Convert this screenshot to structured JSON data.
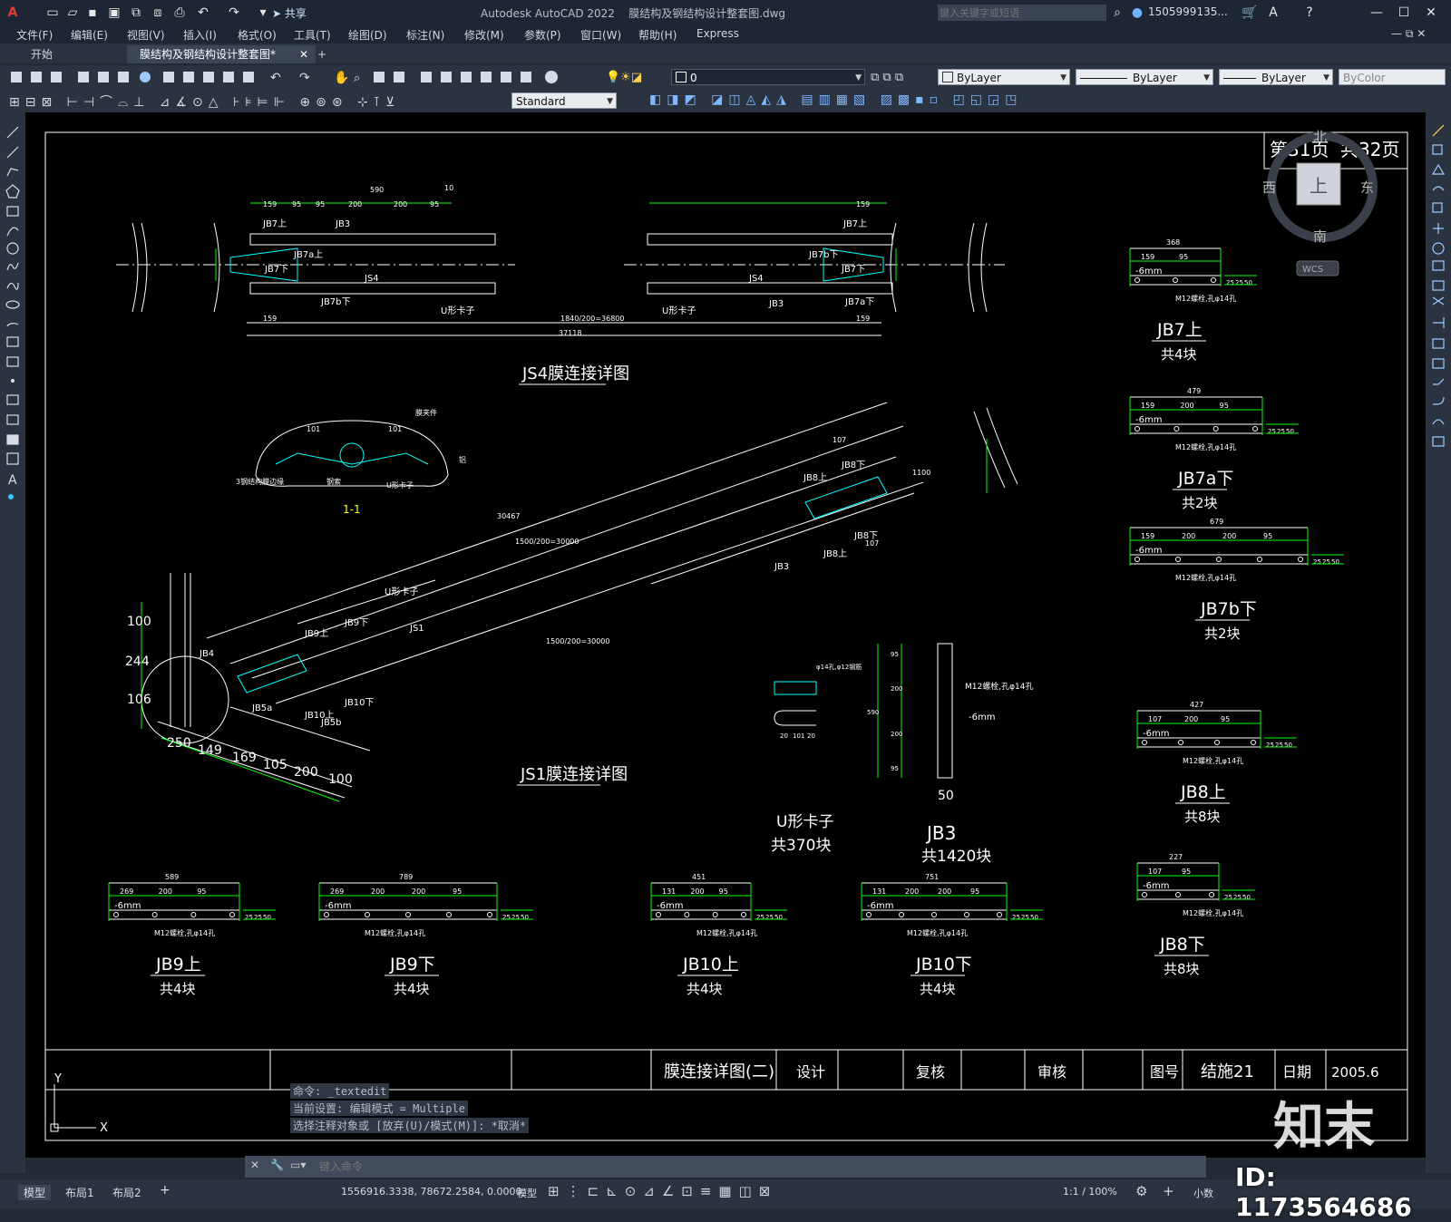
{
  "window": {
    "app_title": "Autodesk AutoCAD 2022",
    "file_name": "膜结构及钢结构设计整套图.dwg",
    "search_placeholder": "键入关键字或短语",
    "user": "1505999135...",
    "share_label": "共享"
  },
  "menu": [
    "文件(F)",
    "编辑(E)",
    "视图(V)",
    "插入(I)",
    "格式(O)",
    "工具(T)",
    "绘图(D)",
    "标注(N)",
    "修改(M)",
    "参数(P)",
    "窗口(W)",
    "帮助(H)",
    "Express"
  ],
  "tabs": {
    "start": "开始",
    "drawing": "膜结构及钢结构设计整套图*",
    "add": "+"
  },
  "toolbar": {
    "layer_value": "0",
    "color_value": "ByLayer",
    "linetype_value": "ByLayer",
    "lineweight_value": "ByLayer",
    "plotstyle_value": "ByColor",
    "textstyle_value": "Standard"
  },
  "viewcube": {
    "north": "北",
    "south": "南",
    "west": "西",
    "east": "东",
    "top": "上",
    "wcs": "WCS"
  },
  "page_number": {
    "current": "第31页",
    "total": "共32页"
  },
  "drawing": {
    "js4_title": "JS4膜连接详图",
    "js1_title": "JS1膜连接详图",
    "section_label": "1-1",
    "js4_dims": [
      "159",
      "95",
      "95",
      "200",
      "200",
      "95",
      "590",
      "10",
      "159",
      "1840/200=36800",
      "37118",
      "159",
      "159"
    ],
    "js4_labels": [
      "JB7上",
      "JB3",
      "JB7a上",
      "JB7下",
      "JS4",
      "JB7b下",
      "U形卡子",
      "JB7上",
      "JB7b下",
      "JS4",
      "JB7下",
      "U形卡子",
      "JB3",
      "JB7a下"
    ],
    "js1_labels": [
      "JB8上",
      "JB8下",
      "JB8下",
      "JB8上",
      "JB3",
      "JB9上",
      "JB9下",
      "JS1",
      "U形卡子",
      "JB4",
      "JB10下",
      "JB10上",
      "JB5a",
      "JB5b"
    ],
    "js1_dims": [
      "107",
      "107",
      "30467",
      "1500/200=30000",
      "1500/200=30000",
      "100",
      "244",
      "106",
      "250",
      "149",
      "169",
      "105",
      "200",
      "100",
      "1100"
    ],
    "section_texts": [
      "101",
      "101",
      "膜夹件",
      "3钢结构膜边缘",
      "U形卡子",
      "钢索",
      "铝"
    ],
    "u_clip": {
      "title": "U形卡子",
      "count": "共370块",
      "note": "φ14孔,φ12钢筋",
      "dims": [
        "20",
        "101",
        "20"
      ]
    },
    "jb3": {
      "title": "JB3",
      "count": "共1420块",
      "note1": "M12螺栓,孔φ14孔",
      "note2": "-6mm",
      "dims": [
        "95",
        "200",
        "200",
        "95",
        "590",
        "50"
      ]
    },
    "plates_right": [
      {
        "name": "JB7上",
        "count": "共4块",
        "total": "368",
        "dims": [
          "159",
          "95"
        ]
      },
      {
        "name": "JB7a下",
        "count": "共2块",
        "total": "479",
        "dims": [
          "159",
          "200",
          "95"
        ]
      },
      {
        "name": "JB7b下",
        "count": "共2块",
        "total": "679",
        "dims": [
          "159",
          "200",
          "200",
          "95"
        ]
      },
      {
        "name": "JB8上",
        "count": "共8块",
        "total": "427",
        "dims": [
          "107",
          "200",
          "95"
        ]
      },
      {
        "name": "JB8下",
        "count": "共8块",
        "total": "227",
        "dims": [
          "107",
          "95"
        ]
      }
    ],
    "plates_bottom": [
      {
        "name": "JB9上",
        "count": "共4块",
        "total": "589",
        "dims": [
          "269",
          "200",
          "95"
        ]
      },
      {
        "name": "JB9下",
        "count": "共4块",
        "total": "789",
        "dims": [
          "269",
          "200",
          "200",
          "95"
        ]
      },
      {
        "name": "JB10上",
        "count": "共4块",
        "total": "451",
        "dims": [
          "131",
          "200",
          "95"
        ]
      },
      {
        "name": "JB10下",
        "count": "共4块",
        "total": "751",
        "dims": [
          "131",
          "200",
          "200",
          "95"
        ]
      }
    ],
    "plate_note_thk": "-6mm",
    "plate_note_bolt": "M12螺栓,孔φ14孔",
    "plate_small_dims": [
      "25",
      "25",
      "50"
    ]
  },
  "title_block": {
    "drawing_name": "膜连接详图(二)",
    "design": "设计",
    "check": "复核",
    "review": "审核",
    "drawing_no_label": "图号",
    "drawing_no": "结施21",
    "date_label": "日期",
    "date": "2005.6"
  },
  "command": {
    "history": [
      "命令: _textedit",
      "当前设置: 编辑模式 = Multiple",
      "选择注释对象或 [放弃(U)/模式(M)]: *取消*"
    ],
    "input_placeholder": "键入命令"
  },
  "status": {
    "model_tab": "模型",
    "layout1": "布局1",
    "layout2": "布局2",
    "coords": "1556916.3338, 78672.2584, 0.0000",
    "model_label": "模型",
    "scale": "1:1 / 100%",
    "units": "小数"
  },
  "watermark": {
    "brand": "知末",
    "id": "ID: 1173564686"
  },
  "colors": {
    "canvas": "#000000",
    "line": "#ffffff",
    "dim": "#00ff00",
    "cyan": "#00ffff",
    "ui_dark": "#1e2633",
    "ui_mid": "#2b3340"
  }
}
